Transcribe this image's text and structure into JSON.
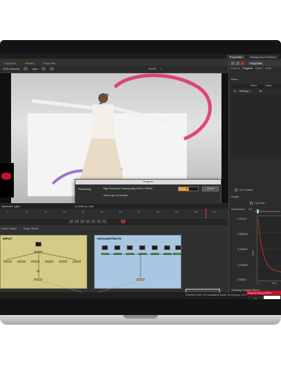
{
  "laptop": {
    "name": "MacBook Pro"
  },
  "topbar": {
    "prop_tabs": [
      "Properties",
      "Background Renders"
    ]
  },
  "viewer_tabs": [
    "CopyCat1",
    "Viewer1",
    "CopyCat1"
  ],
  "viewer_toolbar": {
    "channel": "rgba",
    "layer": "RGB (default)",
    "zoom": "33.3%",
    "frame": "1"
  },
  "viewer": {
    "channels_label": "channels: rgba",
    "coords": "x=2250 y=-348"
  },
  "dialog": {
    "title": "Progress",
    "heading": "Rendering",
    "message": "High Resolution Training (step 29416 / 30000)",
    "eta": "Time to go: 10 minutes",
    "percent_label": "53%",
    "progress": 0.53,
    "cancel_label": "Cancel"
  },
  "timeline": {
    "ticks": [
      "1",
      "10",
      "20",
      "30",
      "40",
      "50",
      "60",
      "70",
      "80",
      "90",
      "100",
      "110"
    ],
    "current_frame": 100
  },
  "node_graph": {
    "tabs": [
      "Node Graph",
      "Dope Sheet"
    ],
    "backdrop_input": "INPUT",
    "backdrop_gt": "GROUNDTRUTH"
  },
  "statusbar": {
    "text": "Channel Count: 33  Localization Mode: On  Memory: 6.5 GB (5.0%)  CPU: 0.0%"
  },
  "right_panel": {
    "node_name": "CopyCat1",
    "tabs": [
      "CopyCat",
      "Progress",
      "Python",
      "Node"
    ],
    "runs_label": "Runs",
    "runs_columns": [
      "Name",
      "Steps"
    ],
    "runs": [
      {
        "name": "Training_2...",
        "steps": "30..."
      }
    ],
    "live_updates": "Live Updates",
    "graph_label": "Graph",
    "log_scale": "Log Scale",
    "smoothness_label": "Smoothness",
    "smoothness_value": "0.6",
    "contact_sheet_label": "Training Contact Sheet"
  },
  "chart_data": {
    "type": "line",
    "title": "",
    "xlabel": "",
    "ylabel": "Loss",
    "y_tick_labels": [
      "0.011117",
      "0.400932",
      "0.400932",
      "0.230200",
      "0.00001"
    ],
    "x_tick_labels": [
      "0",
      "5000"
    ],
    "log_scale": false,
    "grid": true,
    "series": [
      {
        "values": [
          0.011117,
          0.004,
          0.002,
          0.001,
          0.0006,
          0.0004,
          0.0003,
          0.00025,
          0.0002,
          0.00018
        ]
      }
    ]
  },
  "contact_sheet": {
    "header": "Progress    training_0001.tif",
    "captions": [
      "groundTruth",
      "input",
      "groundTruth",
      "output"
    ]
  },
  "colors": {
    "accent": "#f0a030",
    "input_backdrop": "#d4cb86",
    "groundtruth_backdrop": "#a9c6e2",
    "loss_line": "#d42b2b"
  }
}
